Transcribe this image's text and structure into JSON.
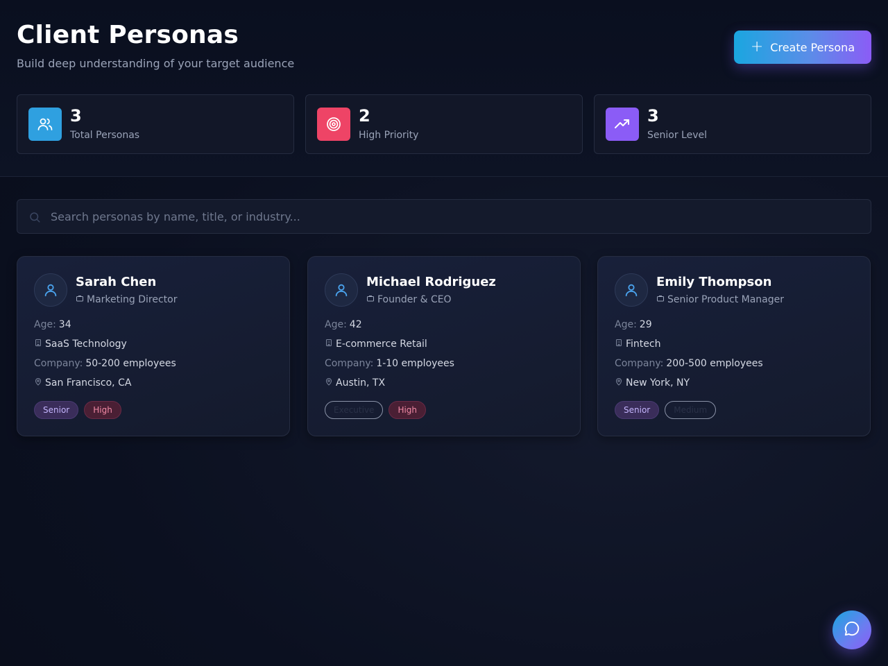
{
  "header": {
    "title": "Client Personas",
    "subtitle": "Build deep understanding of your target audience",
    "create_label": "Create Persona"
  },
  "stats": [
    {
      "value": "3",
      "label": "Total Personas",
      "icon": "users-icon",
      "color": "#2fa0e0"
    },
    {
      "value": "2",
      "label": "High Priority",
      "icon": "target-icon",
      "color": "#ee4466"
    },
    {
      "value": "3",
      "label": "Senior Level",
      "icon": "trending-up-icon",
      "color": "#8b5cf6"
    }
  ],
  "search": {
    "placeholder": "Search personas by name, title, or industry..."
  },
  "personas": [
    {
      "name": "Sarah Chen",
      "title": "Marketing Director",
      "age_label": "Age:",
      "age": "34",
      "industry": "SaaS Technology",
      "company_label": "Company:",
      "company": "50-200 employees",
      "location": "San Francisco, CA",
      "tags": [
        "Senior",
        "High"
      ]
    },
    {
      "name": "Michael Rodriguez",
      "title": "Founder & CEO",
      "age_label": "Age:",
      "age": "42",
      "industry": "E-commerce Retail",
      "company_label": "Company:",
      "company": "1-10 employees",
      "location": "Austin, TX",
      "tags": [
        "Executive",
        "High"
      ]
    },
    {
      "name": "Emily Thompson",
      "title": "Senior Product Manager",
      "age_label": "Age:",
      "age": "29",
      "industry": "Fintech",
      "company_label": "Company:",
      "company": "200-500 employees",
      "location": "New York, NY",
      "tags": [
        "Senior",
        "Medium"
      ]
    }
  ],
  "colors": {
    "accent_start": "#1aa6e0",
    "accent_end": "#8b5cf6",
    "background": "#0d1220"
  }
}
